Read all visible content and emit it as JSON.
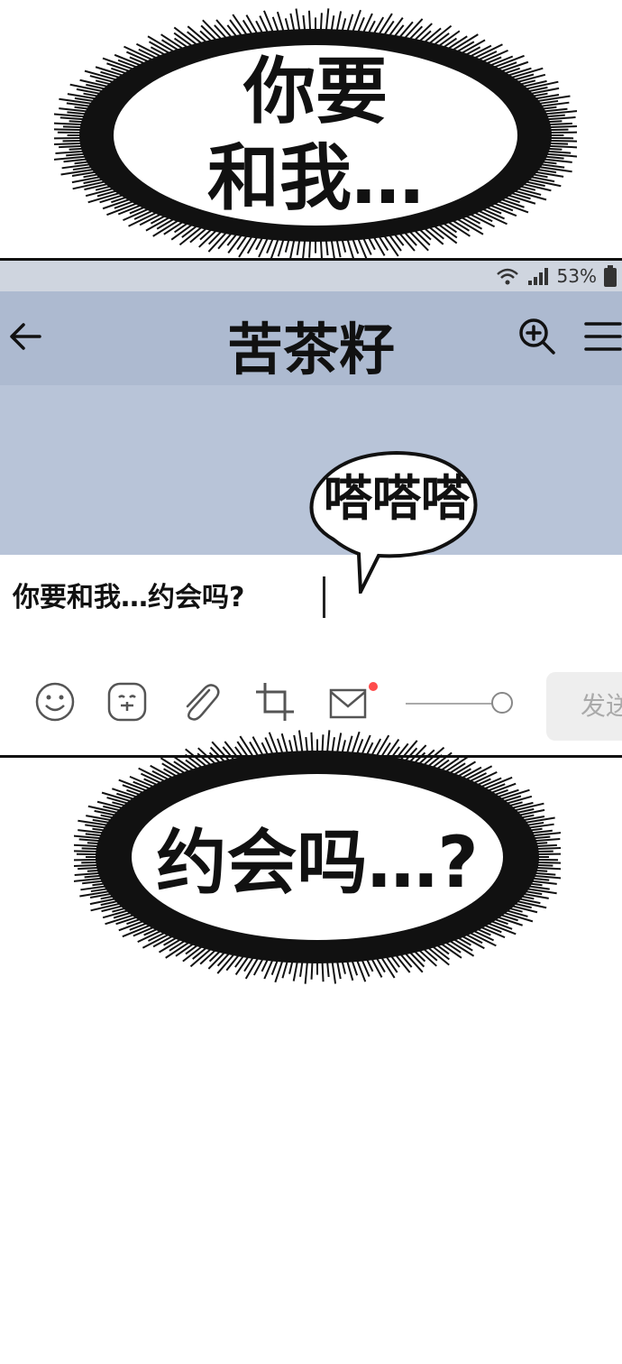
{
  "bursts": {
    "top": {
      "line1": "你要",
      "line2": "和我…"
    },
    "bottom": {
      "text": "约会吗…?"
    }
  },
  "status_bar": {
    "battery_percent": "53%"
  },
  "chat": {
    "title": "苦茶籽",
    "input_value": "你要和我…约会吗?",
    "send_label": "发送",
    "sound_effect": "嗒嗒嗒"
  },
  "icons": {
    "back": "back-arrow-icon",
    "zoom": "zoom-in-icon",
    "menu": "menu-icon",
    "toolbar": [
      "smiley-icon",
      "sticker-icon",
      "paperclip-icon",
      "crop-icon",
      "mail-icon"
    ]
  },
  "colors": {
    "header_bg": "#adbad0",
    "chat_bg": "#b8c4d8",
    "notification_dot": "#ff4b4b"
  }
}
